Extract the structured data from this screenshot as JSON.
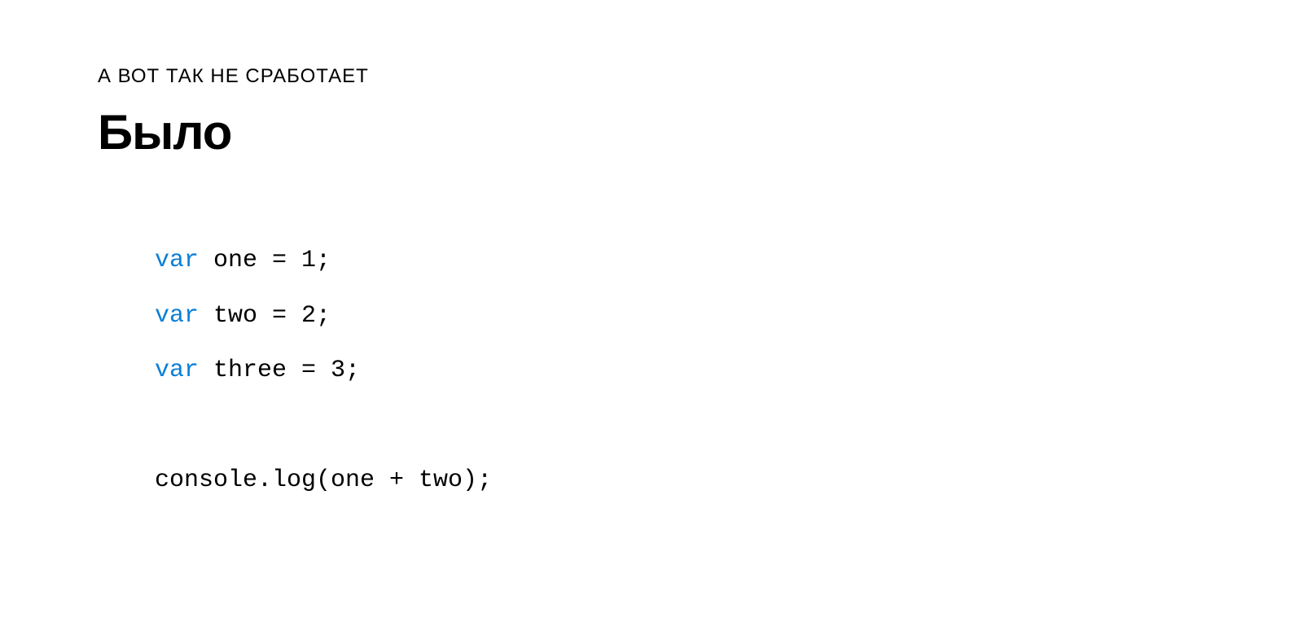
{
  "eyebrow": "А ВОТ ТАК НЕ СРАБОТАЕТ",
  "title": "Было",
  "code": {
    "keyword": "var",
    "line1_rest": " one = 1;",
    "line2_rest": " two = 2;",
    "line3_rest": " three = 3;",
    "line5": "console.log(one + two);"
  },
  "colors": {
    "keyword": "#0b7fd6",
    "text": "#000000",
    "background": "#ffffff"
  }
}
